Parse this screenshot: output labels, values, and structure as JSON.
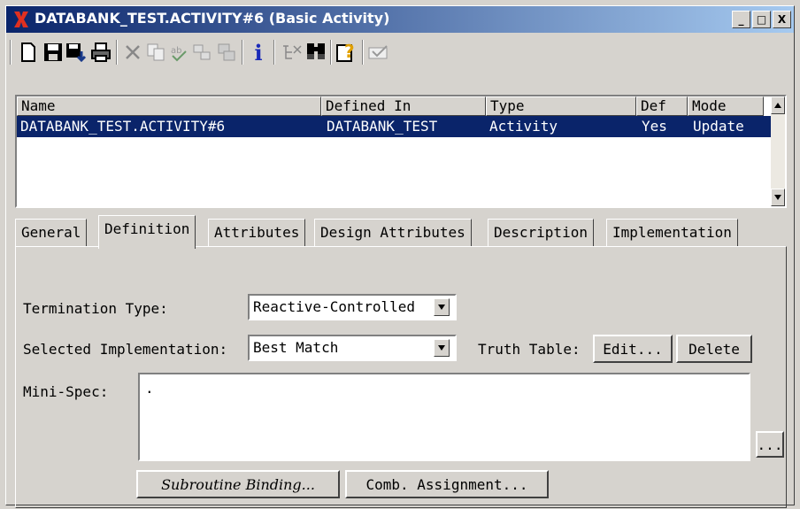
{
  "window": {
    "title": "DATABANK_TEST.ACTIVITY#6 (Basic Activity)",
    "minimize": "_",
    "maximize": "□",
    "close": "X"
  },
  "toolbar": {
    "icons": [
      "new-icon",
      "save-icon",
      "save-all-icon",
      "print-icon",
      "delete-icon",
      "copy-icon",
      "spell-check-icon",
      "replace-icon",
      "compare-icon",
      "info-icon",
      "tree-icon",
      "find-icon",
      "help-icon",
      "check-icon"
    ],
    "info_glyph": "i",
    "help_glyph": "?"
  },
  "list": {
    "columns": [
      "Name",
      "Defined In",
      "Type",
      "Def",
      "Mode"
    ],
    "rows": [
      {
        "name": "DATABANK_TEST.ACTIVITY#6",
        "defined_in": "DATABANK_TEST",
        "type": "Activity",
        "def": "Yes",
        "mode": "Update"
      }
    ]
  },
  "tabs": [
    "General",
    "Definition",
    "Attributes",
    "Design Attributes",
    "Description",
    "Implementation"
  ],
  "active_tab": "Definition",
  "definition": {
    "termination_label": "Termination Type:",
    "termination_value": "Reactive-Controlled",
    "implementation_label": "Selected Implementation:",
    "implementation_value": "Best Match",
    "truth_table_label": "Truth Table:",
    "edit_button": "Edit...",
    "delete_button": "Delete",
    "mini_spec_label": "Mini-Spec:",
    "mini_spec_value": ".",
    "more_button": "...",
    "subroutine_button": "Subroutine Binding...",
    "comb_button": "Comb. Assignment..."
  },
  "colors": {
    "title_start": "#0a246a",
    "title_end": "#a6caf0",
    "selection": "#0a246a",
    "face": "#d6d3ce"
  }
}
